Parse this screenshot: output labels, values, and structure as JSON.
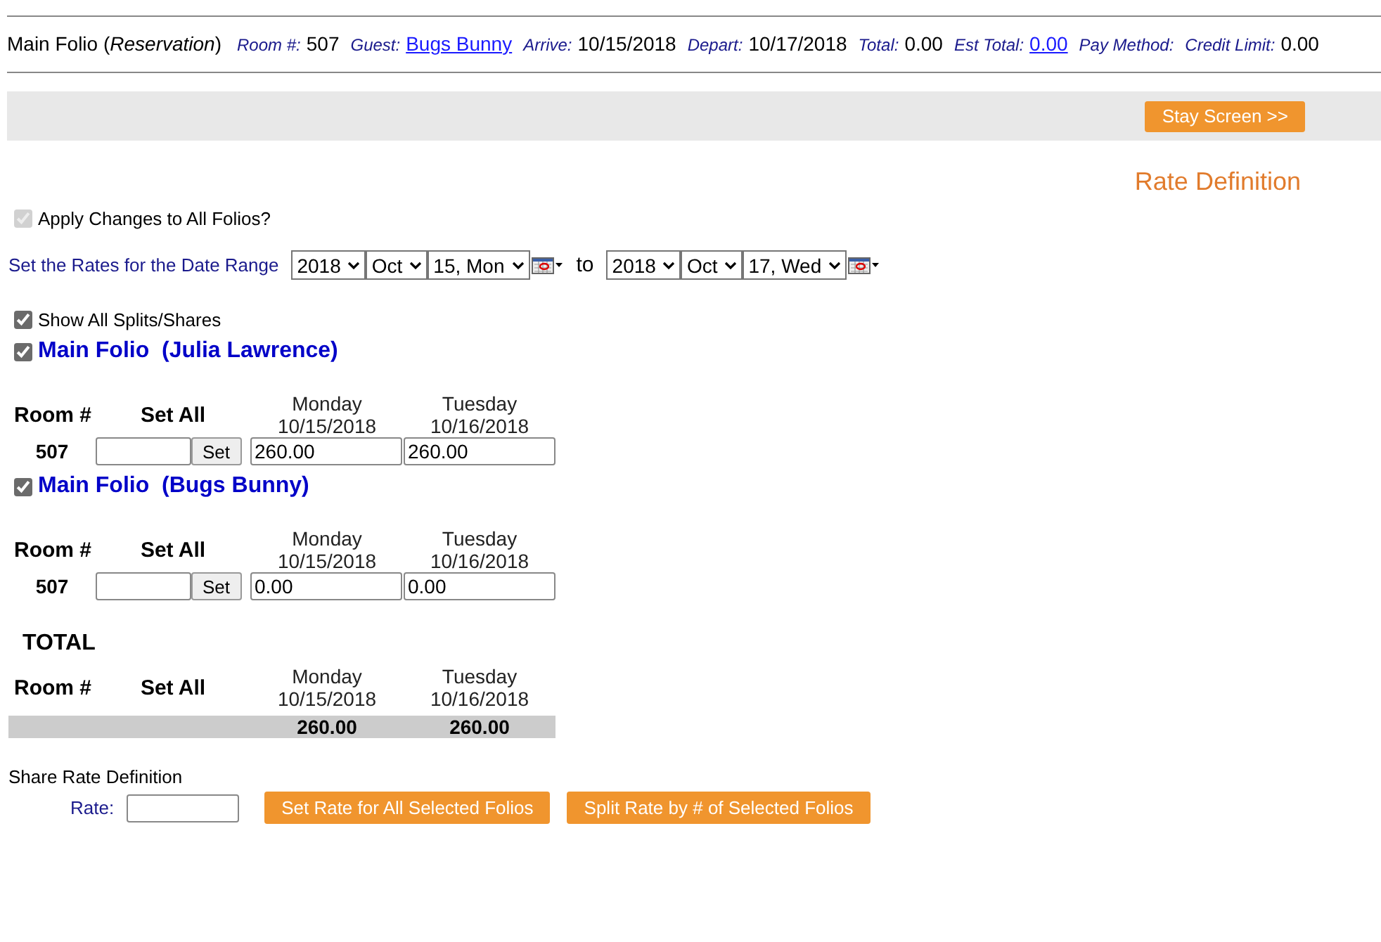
{
  "header": {
    "title": "Main Folio (*Reservation*)",
    "fields": [
      {
        "label": "Room #:",
        "value": "507",
        "link": false
      },
      {
        "label": "Guest:",
        "value": "Bugs Bunny",
        "link": true
      },
      {
        "label": "Arrive:",
        "value": "10/15/2018",
        "link": false
      },
      {
        "label": "Depart:",
        "value": "10/17/2018",
        "link": false
      },
      {
        "label": "Total:",
        "value": "0.00",
        "link": false
      },
      {
        "label": "Est Total:",
        "value": "0.00",
        "link": true
      },
      {
        "label": "Pay Method:"
      },
      {
        "label": "Credit Limit:",
        "value": "0.00",
        "link": false
      }
    ]
  },
  "stay_button": "Stay Screen >>",
  "page_title": "Rate Definition",
  "apply_all": {
    "label": "Apply Changes to All Folios?",
    "checked": true,
    "disabled": true
  },
  "date_range": {
    "label": "Set the Rates for the Date Range",
    "from": [
      "2018",
      "Oct",
      "15, Mon"
    ],
    "to_label": "to",
    "to": [
      "2018",
      "Oct",
      "17, Wed"
    ]
  },
  "show_splits": {
    "label": "Show All Splits/Shares",
    "checked": true
  },
  "folios": [
    {
      "title": "Main Folio  (Julia Lawrence)",
      "checked": true,
      "columns": [
        "Room #",
        "Set All"
      ],
      "days": [
        {
          "day": "Monday",
          "date": "10/15/2018"
        },
        {
          "day": "Tuesday",
          "date": "10/16/2018"
        }
      ],
      "rows": [
        {
          "room": "507",
          "set_button": "Set",
          "rates": [
            "260.00",
            "260.00"
          ]
        }
      ]
    },
    {
      "title": "Main Folio  (Bugs Bunny)",
      "checked": true,
      "columns": [
        "Room #",
        "Set All"
      ],
      "days": [
        {
          "day": "Monday",
          "date": "10/15/2018"
        },
        {
          "day": "Tuesday",
          "date": "10/16/2018"
        }
      ],
      "rows": [
        {
          "room": "507",
          "set_button": "Set",
          "rates": [
            "0.00",
            "0.00"
          ]
        }
      ]
    }
  ],
  "total": {
    "title": "TOTAL",
    "columns": [
      "Room #",
      "Set All"
    ],
    "days": [
      {
        "day": "Monday",
        "date": "10/15/2018"
      },
      {
        "day": "Tuesday",
        "date": "10/16/2018"
      }
    ],
    "totals": [
      "260.00",
      "260.00"
    ]
  },
  "share": {
    "title": "Share Rate Definition",
    "rate_label": "Rate:",
    "buttons": [
      "Set Rate for All Selected Folios",
      "Split Rate by # of Selected Folios"
    ]
  }
}
